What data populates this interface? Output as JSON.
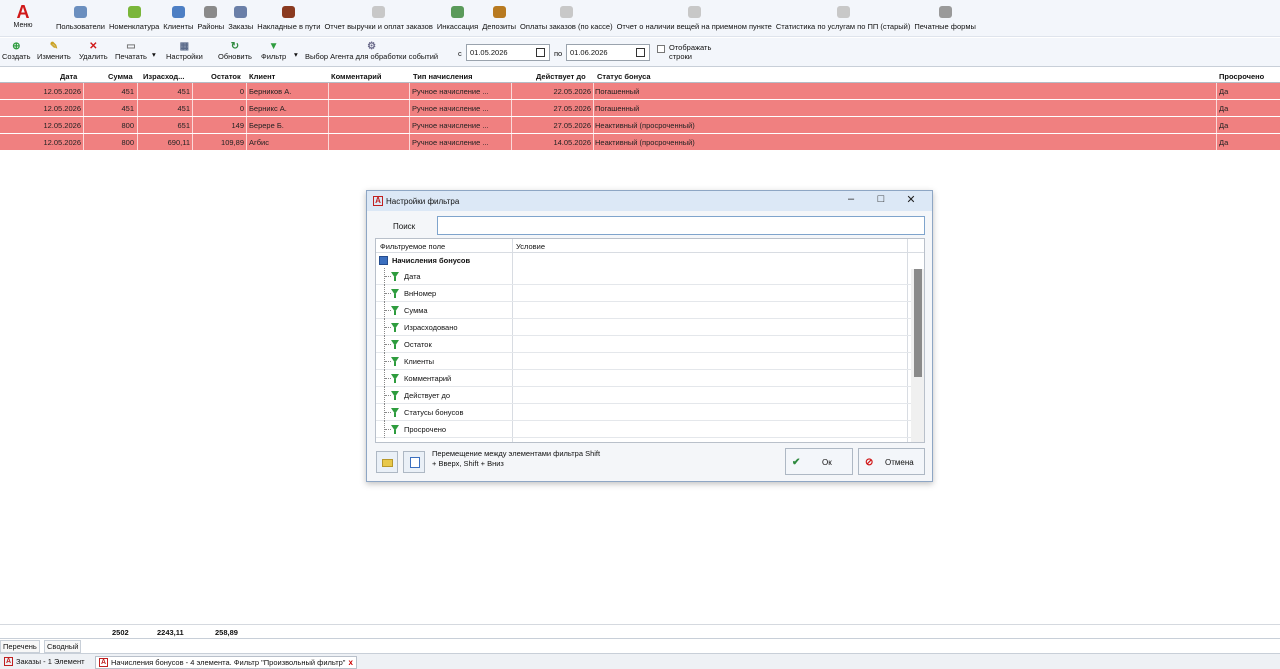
{
  "menu": {
    "label": "Меню"
  },
  "nav": [
    {
      "label": "Пользователи",
      "icon": "users-icon",
      "color": "#6b8fbf"
    },
    {
      "label": "Номенклатура",
      "icon": "nomenclature-icon",
      "color": "#7ab63a"
    },
    {
      "label": "Клиенты",
      "icon": "clients-icon",
      "color": "#4d7fc4"
    },
    {
      "label": "Районы",
      "icon": "districts-icon",
      "color": "#8a8a8a"
    },
    {
      "label": "Заказы",
      "icon": "orders-icon",
      "color": "#6a7fa8"
    },
    {
      "label": "Накладные в пути",
      "icon": "waybill-icon",
      "color": "#8a3a20"
    },
    {
      "label": "Отчет выручки и оплат заказов",
      "icon": "report-icon",
      "color": "#c8c8c8"
    },
    {
      "label": "Инкассация",
      "icon": "collection-icon",
      "color": "#5a9a5a"
    },
    {
      "label": "Депозиты",
      "icon": "deposits-icon",
      "color": "#b87a20"
    },
    {
      "label": "Оплаты заказов (по кассе)",
      "icon": "payments-icon",
      "color": "#c8c8c8"
    },
    {
      "label": "Отчет о наличии вещей на приемном пункте",
      "icon": "report-icon",
      "color": "#c8c8c8"
    },
    {
      "label": "Статистика по услугам по ПП (старый)",
      "icon": "stats-icon",
      "color": "#c8c8c8"
    },
    {
      "label": "Печатные формы",
      "icon": "print-forms-icon",
      "color": "#9a9a9a"
    }
  ],
  "actions": {
    "create": "Создать",
    "edit": "Изменить",
    "delete": "Удалить",
    "print": "Печатать",
    "settings": "Настройки",
    "refresh": "Обновить",
    "filter": "Фильтр",
    "agent": "Выбор Агента для обработки событий"
  },
  "period": {
    "from_label": "с",
    "from": "01.05.2026",
    "to_label": "по",
    "to": "01.06.2026",
    "show_rows": "Отображать строки"
  },
  "grid": {
    "columns": [
      "Дата",
      "Сумма",
      "Израсход...",
      "Остаток",
      "Клиент",
      "Комментарий",
      "Тип начисления",
      "Действует до",
      "Статус бонуса",
      "Просрочено"
    ],
    "rows": [
      [
        "12.05.2026",
        "451",
        "451",
        "0",
        "Берников А.",
        "",
        "Ручное начисление ...",
        "22.05.2026",
        "Погашенный",
        "Да"
      ],
      [
        "12.05.2026",
        "451",
        "451",
        "0",
        "Берникс А.",
        "",
        "Ручное начисление ...",
        "27.05.2026",
        "Погашенный",
        "Да"
      ],
      [
        "12.05.2026",
        "800",
        "651",
        "149",
        "Берере Б.",
        "",
        "Ручное начисление ...",
        "27.05.2026",
        "Неактивный (просроченный)",
        "Да"
      ],
      [
        "12.05.2026",
        "800",
        "690,11",
        "109,89",
        "Агбис",
        "",
        "Ручное начисление ...",
        "14.05.2026",
        "Неактивный (просроченный)",
        "Да"
      ]
    ],
    "totals": {
      "sum": "2502",
      "spent": "2243,11",
      "rest": "258,89"
    },
    "row_color": "#f08080"
  },
  "view_tabs": [
    "Перечень",
    "Сводный"
  ],
  "doc_tabs": [
    {
      "label": "Заказы - 1 Элемент"
    },
    {
      "label": "Начисления бонусов - 4 элемента. Фильтр \"Произвольный фильтр\"",
      "close": "x"
    }
  ],
  "dialog": {
    "title": "Настройки фильтра",
    "minimize": "–",
    "maximize": "□",
    "close": "✕",
    "search_label": "Поиск",
    "search_value": "",
    "col_field": "Фильтруемое поле",
    "col_condition": "Условие",
    "group": "Начисления бонусов",
    "fields": [
      "Дата",
      "ВнНомер",
      "Сумма",
      "Израсходовано",
      "Остаток",
      "Клиенты",
      "Комментарий",
      "Действует до",
      "Статусы бонусов",
      "Просрочено"
    ],
    "hint": "Перемещение между элементами фильтра Shift + Вверх, Shift + Вниз",
    "ok": "Ок",
    "cancel": "Отмена"
  }
}
